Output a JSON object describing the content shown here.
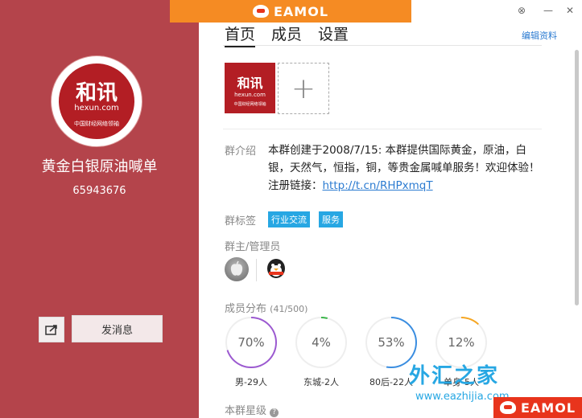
{
  "banner": {
    "brand": "EAMOL"
  },
  "window": {
    "minimize": "—",
    "close": "✕",
    "settings_icon": "⊗"
  },
  "profile": {
    "logo_big": "和讯",
    "logo_domain": "hexun.com",
    "logo_tagline": "中国财经网络领袖",
    "group_name": "黄金白银原油喊单",
    "group_id": "65943676",
    "send_label": "发消息"
  },
  "tabs": [
    {
      "label": "首页"
    },
    {
      "label": "成员"
    },
    {
      "label": "设置"
    }
  ],
  "edit_label": "编辑资料",
  "intro": {
    "label": "群介绍",
    "text": "本群创建于2008/7/15: 本群提供国际黄金，原油，白银，天然气，恒指，铜，等贵金属喊单服务！欢迎体验！",
    "link_prefix": "注册链接：",
    "link": "http://t.cn/RHPxmqT"
  },
  "tags": {
    "label": "群标签",
    "items": [
      "行业交流",
      "服务"
    ]
  },
  "owners": {
    "label": "群主/管理员"
  },
  "distribution": {
    "label": "成员分布",
    "count": "(41/500)",
    "items": [
      {
        "percent": "70%",
        "label": "男-29人",
        "value": 0.7,
        "color": "#9b59d0"
      },
      {
        "percent": "4%",
        "label": "东城-2人",
        "value": 0.04,
        "color": "#3ab54a"
      },
      {
        "percent": "53%",
        "label": "80后-22人",
        "value": 0.53,
        "color": "#3a8de0"
      },
      {
        "percent": "12%",
        "label": "单身-5人",
        "value": 0.12,
        "color": "#f5a623"
      }
    ]
  },
  "stars": {
    "label": "本群星级"
  },
  "watermark": {
    "text": "外汇之家",
    "url": "www.eazhijia.com",
    "brand": "EAMOL"
  }
}
